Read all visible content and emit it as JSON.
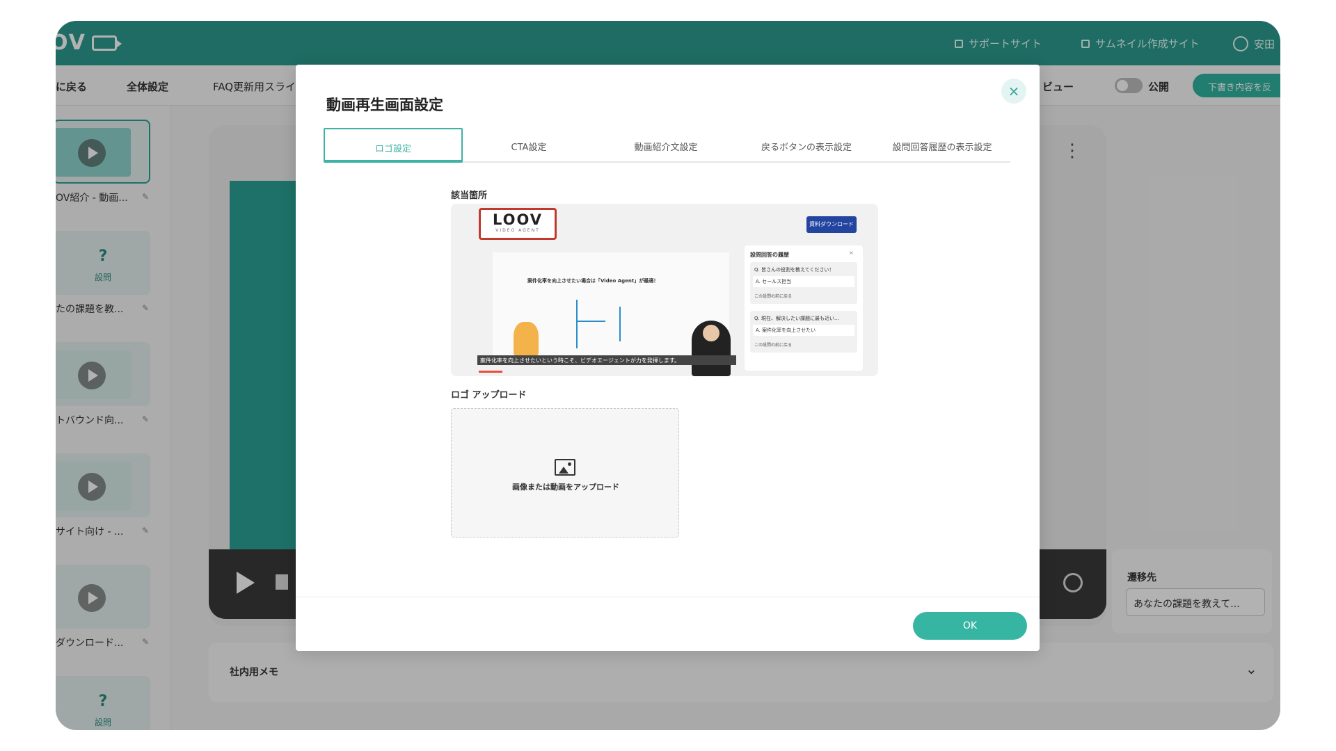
{
  "app": {
    "topbar": {
      "support_link": "サポートサイト",
      "thumbnail_link": "サムネイル作成サイト",
      "user_name": "安田"
    },
    "subbar": {
      "back": "に戻る",
      "global_settings": "全体設定",
      "slide_name": "FAQ更新用スライ",
      "preview": "ビュー",
      "publish": "公開",
      "draft": "下書き内容を反"
    },
    "scenes": [
      {
        "type": "video",
        "label": "OV紹介 - 動画..."
      },
      {
        "type": "question",
        "q": "?",
        "q_label": "設問",
        "label": "たの課題を教..."
      },
      {
        "type": "video",
        "label": "トバウンド向..."
      },
      {
        "type": "video",
        "label": "サイト向け - ..."
      },
      {
        "type": "video",
        "label": "ダウンロード..."
      },
      {
        "type": "question",
        "q": "?",
        "q_label": "設問",
        "label": ""
      }
    ],
    "transition": {
      "label": "遷移先",
      "value": "あなたの課題を教えて..."
    },
    "memo": {
      "label": "社内用メモ"
    }
  },
  "modal": {
    "title": "動画再生画面設定",
    "close": "×",
    "tabs": [
      {
        "label": "ロゴ設定",
        "active": true
      },
      {
        "label": "CTA設定",
        "active": false
      },
      {
        "label": "動画紹介文設定",
        "active": false
      },
      {
        "label": "戻るボタンの表示設定",
        "active": false
      },
      {
        "label": "設問回答履歴の表示設定",
        "active": false
      }
    ],
    "section_target": "該当箇所",
    "preview": {
      "logo_text": "LOOV",
      "logo_sub": "VIDEO AGENT",
      "download_btn": "資料ダウンロード",
      "headline": "案件化率を向上させたい場合は「Video Agent」が最適！",
      "subtitle": "案件化率を向上させたいという時こそ、ビデオエージェントが力を発揮します。",
      "panel_title": "設問回答の履歴",
      "panel_close": "×",
      "qa": [
        {
          "q": "Q. 皆さんの役割を教えてください！",
          "a": "A. セールス担当",
          "back": "この設問の前に戻る"
        },
        {
          "q": "Q. 現在、解決したい課題に最も近い...",
          "a": "A. 案件化率を向上させたい",
          "back": "この設問の前に戻る"
        }
      ]
    },
    "section_upload": "ロゴ アップロード",
    "upload_text": "画像または動画をアップロード",
    "ok": "OK"
  },
  "colors": {
    "brand": "#2b9b8e",
    "accent": "#36b5a3",
    "logo_border": "#c0392b",
    "download_btn": "#2345a0"
  }
}
